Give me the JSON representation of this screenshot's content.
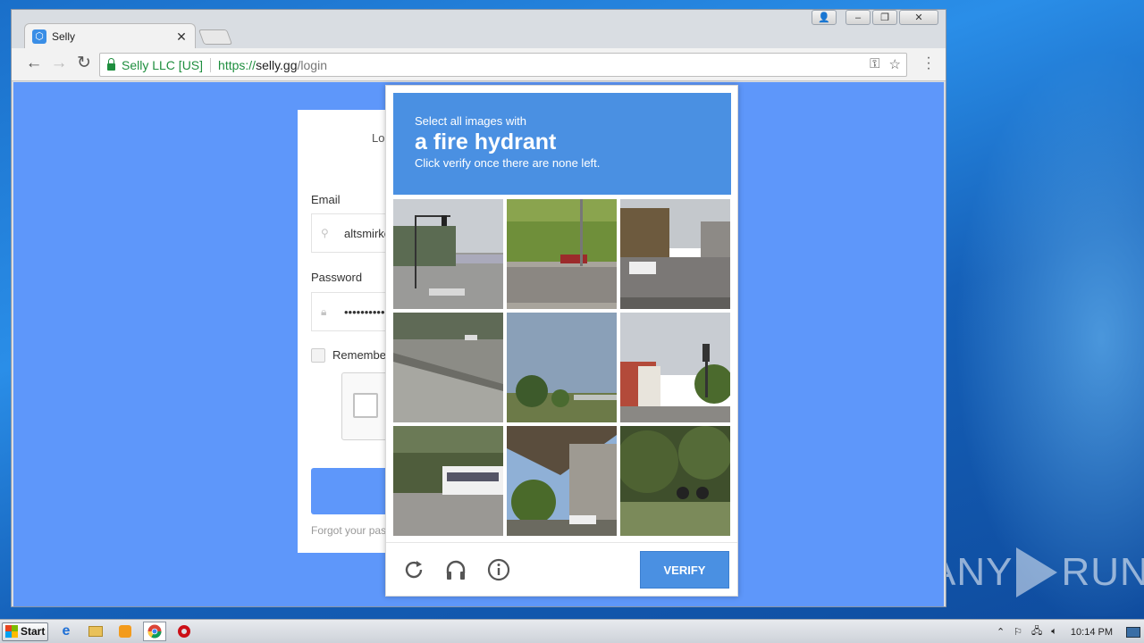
{
  "browser": {
    "tab_title": "Selly",
    "tab_close": "✕",
    "secure_label": "Selly LLC [US]",
    "url_scheme": "https://",
    "url_host": "selly.gg",
    "url_path": "/login"
  },
  "login": {
    "title": "Log",
    "email_label": "Email",
    "email_value": "altsmirkc",
    "password_label": "Password",
    "password_value": "••••••••••",
    "remember_label": "Remember",
    "forgot_text": "Forgot your pas"
  },
  "captcha": {
    "prompt_small": "Select all images with",
    "prompt_target": "a fire hydrant",
    "prompt_sub": "Click verify once there are none left.",
    "verify_label": "VERIFY",
    "tiles": [
      "street-intersection-with-traffic-light",
      "grass-hill-with-concrete-wall",
      "residential-street-with-cars",
      "highway-concrete-barrier",
      "park-with-trees",
      "street-with-traffic-light-and-houses",
      "road-with-white-bus",
      "underpass-with-trees",
      "trees-and-motorcycle"
    ]
  },
  "watermark": {
    "left": "ANY",
    "right": "RUN"
  },
  "taskbar": {
    "start_label": "Start",
    "clock": "10:14 PM"
  },
  "colors": {
    "page_bg": "#5e97fa",
    "captcha_accent": "#4a90e2",
    "secure_green": "#1e8e3e"
  }
}
